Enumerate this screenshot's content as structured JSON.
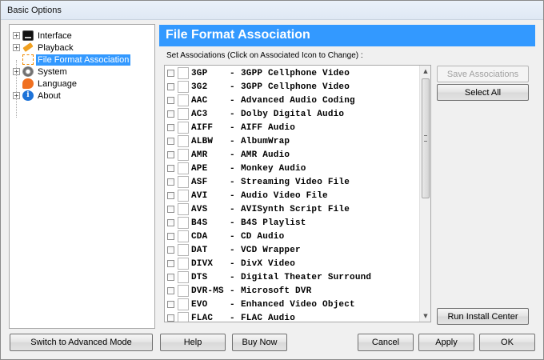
{
  "window": {
    "title": "Basic Options"
  },
  "tree": {
    "items": [
      {
        "label": "Interface",
        "icon": "monitor-icon"
      },
      {
        "label": "Playback",
        "icon": "pencil-icon"
      },
      {
        "label": "File Format Association",
        "icon": "file-association-icon",
        "selected": true
      },
      {
        "label": "System",
        "icon": "gear-icon"
      },
      {
        "label": "Language",
        "icon": "speech-bubble-icon"
      },
      {
        "label": "About",
        "icon": "info-icon"
      }
    ]
  },
  "main": {
    "header": "File Format Association",
    "subtitle": "Set Associations (Click on Associated Icon to Change) :",
    "formats": [
      {
        "ext": "3GP",
        "desc": "3GPP Cellphone Video"
      },
      {
        "ext": "3G2",
        "desc": "3GPP Cellphone Video"
      },
      {
        "ext": "AAC",
        "desc": "Advanced Audio Coding"
      },
      {
        "ext": "AC3",
        "desc": "Dolby Digital Audio"
      },
      {
        "ext": "AIFF",
        "desc": "AIFF Audio"
      },
      {
        "ext": "ALBW",
        "desc": "AlbumWrap"
      },
      {
        "ext": "AMR",
        "desc": "AMR Audio"
      },
      {
        "ext": "APE",
        "desc": "Monkey Audio"
      },
      {
        "ext": "ASF",
        "desc": "Streaming Video File"
      },
      {
        "ext": "AVI",
        "desc": "Audio Video File"
      },
      {
        "ext": "AVS",
        "desc": "AVISynth Script File"
      },
      {
        "ext": "B4S",
        "desc": "B4S Playlist"
      },
      {
        "ext": "CDA",
        "desc": "CD Audio"
      },
      {
        "ext": "DAT",
        "desc": "VCD Wrapper"
      },
      {
        "ext": "DIVX",
        "desc": "DivX Video"
      },
      {
        "ext": "DTS",
        "desc": "Digital Theater Surround"
      },
      {
        "ext": "DVR-MS",
        "desc": "Microsoft DVR"
      },
      {
        "ext": "EVO",
        "desc": "Enhanced Video Object"
      },
      {
        "ext": "FLAC",
        "desc": "FLAC Audio"
      }
    ],
    "dash": "-"
  },
  "side_buttons": {
    "save": "Save Associations",
    "select_all": "Select All",
    "run_install": "Run Install Center"
  },
  "footer": {
    "advanced": "Switch to Advanced Mode",
    "help": "Help",
    "buy": "Buy Now",
    "cancel": "Cancel",
    "apply": "Apply",
    "ok": "OK"
  }
}
